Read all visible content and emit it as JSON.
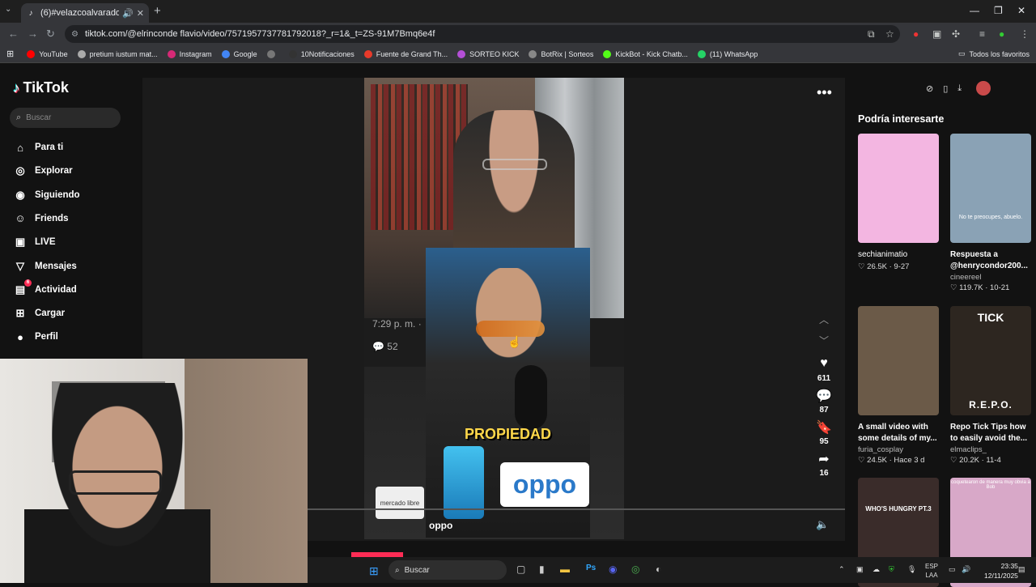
{
  "browser": {
    "tab_title": "(6)#velazcoalvarado #peru",
    "url": "tiktok.com/@elrinconde flavio/video/7571957737781792018?_r=1&_t=ZS-91M7Bmq6e4f",
    "bookmarks": [
      {
        "label": "YouTube",
        "color": "#ff0000",
        "icon": "youtube-icon"
      },
      {
        "label": "pretium iustum mat...",
        "color": "#aaaaaa",
        "icon": "globe-icon"
      },
      {
        "label": "Instagram",
        "color": "#d62976",
        "icon": "instagram-icon"
      },
      {
        "label": "Google",
        "color": "#4285f4",
        "icon": "google-icon"
      },
      {
        "label": "",
        "color": "#777777",
        "icon": "globe-icon"
      },
      {
        "label": "10Notificaciones",
        "color": "#333333",
        "icon": "x-icon"
      },
      {
        "label": "Fuente de Grand Th...",
        "color": "#e83a2a",
        "icon": "f-icon"
      },
      {
        "label": "SORTEO KICK",
        "color": "#b44fd6",
        "icon": "kick-icon"
      },
      {
        "label": "BotRix | Sorteos",
        "color": "#888888",
        "icon": "botrix-icon"
      },
      {
        "label": "KickBot - Kick Chatb...",
        "color": "#53fc18",
        "icon": "kickbot-icon"
      },
      {
        "label": "(11) WhatsApp",
        "color": "#25d366",
        "icon": "whatsapp-icon"
      }
    ],
    "all_favorites": "Todos los favoritos"
  },
  "tiktok": {
    "logo": "TikTok",
    "search_placeholder": "Buscar",
    "nav": [
      {
        "label": "Para ti",
        "icon": "home-icon"
      },
      {
        "label": "Explorar",
        "icon": "compass-icon"
      },
      {
        "label": "Siguiendo",
        "icon": "following-icon"
      },
      {
        "label": "Friends",
        "icon": "friends-icon"
      },
      {
        "label": "LIVE",
        "icon": "live-icon"
      },
      {
        "label": "Mensajes",
        "icon": "messages-icon"
      },
      {
        "label": "Actividad",
        "icon": "activity-icon",
        "badge": "6"
      },
      {
        "label": "Cargar",
        "icon": "upload-icon"
      },
      {
        "label": "Perfil",
        "icon": "profile-icon"
      }
    ],
    "video": {
      "overlay_time": "7:29 p. m. ·",
      "overlay_comments": "52",
      "caption": "PROPIEDAD",
      "brand": "oppo",
      "brand_small": "oppo",
      "mercado": "mercado libre"
    },
    "actions": {
      "likes": "611",
      "comments": "87",
      "saves": "95",
      "shares": "16"
    },
    "recommend": {
      "title": "Podría interesarte",
      "cards": [
        {
          "desc": "",
          "user": "sechianimatio",
          "stats": "♡ 26.5K · 9-27",
          "thumb_color": "#f3b6e1",
          "thumb_text": ""
        },
        {
          "desc": "Respuesta a @henrycondor200...",
          "user": "cineereel",
          "stats": "♡ 119.7K · 10-21",
          "thumb_color": "#8aa2b5",
          "thumb_text": "No te preocupes, abuelo."
        },
        {
          "desc": "A small video with some details of my...",
          "user": "furia_cosplay",
          "stats": "♡ 24.5K · Hace 3 d",
          "thumb_color": "#6b5a48",
          "thumb_text": ""
        },
        {
          "desc": "Repo Tick Tips how to easily avoid the...",
          "user": "elmaclips_",
          "stats": "♡ 20.2K · 11-4",
          "thumb_color": "#2d2620",
          "thumb_text": "TICK",
          "thumb_text2": "R.E.P.O."
        },
        {
          "desc": "",
          "user": "",
          "stats": "",
          "thumb_color": "#3a2c2a",
          "thumb_text": "WHO'S HUNGRY PT.3"
        },
        {
          "desc": "",
          "user": "",
          "stats": "",
          "thumb_color": "#d8a8c8",
          "thumb_text": "coquetearon de manera muy obvia a Bob"
        }
      ]
    }
  },
  "taskbar": {
    "search": "Buscar",
    "lang_top": "ESP",
    "lang_bottom": "LAA",
    "time": "23:35",
    "date": "12/11/2025"
  }
}
